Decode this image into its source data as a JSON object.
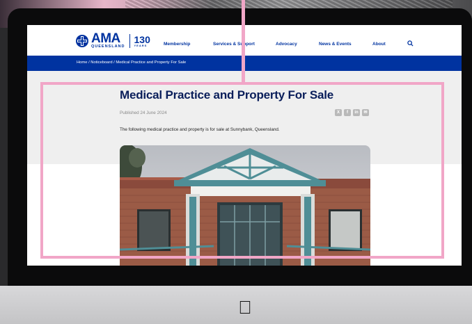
{
  "logo": {
    "brand": "AMA",
    "region": "QUEENSLAND",
    "years": "130",
    "years_sub": "YEARS"
  },
  "nav": {
    "items": [
      {
        "label": "Membership"
      },
      {
        "label": "Services & Support"
      },
      {
        "label": "Advocacy"
      },
      {
        "label": "News & Events"
      },
      {
        "label": "About"
      }
    ],
    "search_icon": "search-icon"
  },
  "breadcrumb": {
    "text": "Home /  Noticeboard  /  Medical Practice and Property For Sale"
  },
  "article": {
    "title": "Medical Practice and Property For Sale",
    "published": "Published 24 June 2024",
    "intro": "The following medical practice and property is for sale at Sunnybank, Queensland.",
    "share_icons": [
      "x-icon",
      "facebook-icon",
      "linkedin-icon",
      "email-icon"
    ]
  },
  "colors": {
    "brand_blue": "#0033a0",
    "title_navy": "#0a1e5a",
    "highlight_pink": "#f1a6c7"
  }
}
